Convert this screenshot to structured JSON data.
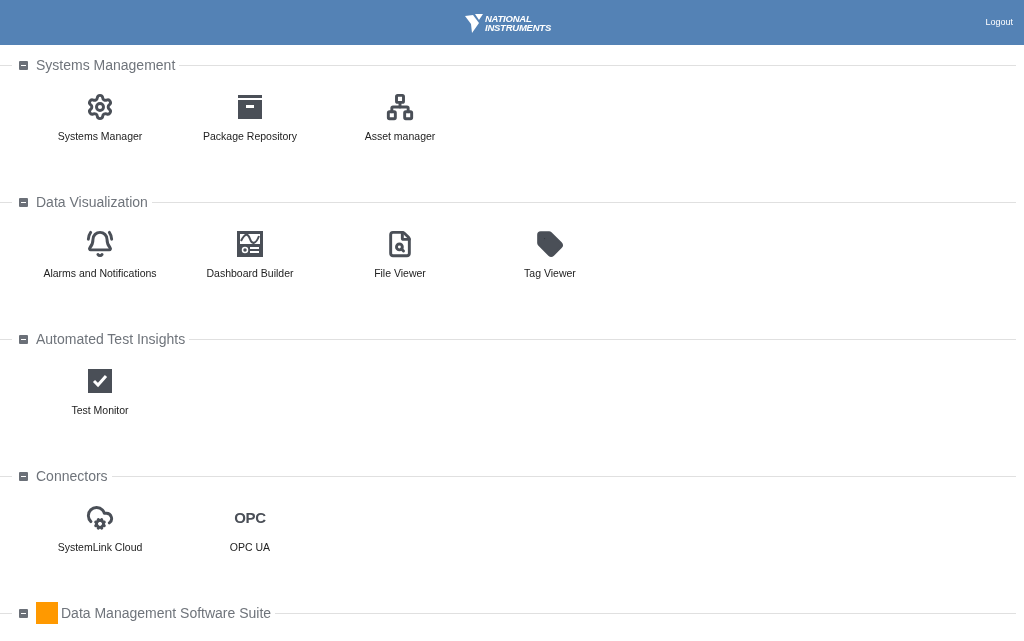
{
  "header": {
    "logo": {
      "line_1": "NATIONAL",
      "line_2": "INSTRUMENTS"
    },
    "logout": "Logout"
  },
  "sections": [
    {
      "title": "Systems Management",
      "expanded": true,
      "badge": false,
      "items": [
        {
          "kind": "gears",
          "label": "Systems Manager"
        },
        {
          "kind": "archive",
          "label": "Package Repository"
        },
        {
          "kind": "hierarchy",
          "label": "Asset manager"
        }
      ]
    },
    {
      "title": "Data Visualization",
      "expanded": true,
      "badge": false,
      "items": [
        {
          "kind": "bell",
          "label": "Alarms and Notifications"
        },
        {
          "kind": "dashboard",
          "label": "Dashboard Builder"
        },
        {
          "kind": "file-search",
          "label": "File Viewer"
        },
        {
          "kind": "tag",
          "label": "Tag Viewer"
        }
      ]
    },
    {
      "title": "Automated Test Insights",
      "expanded": true,
      "badge": false,
      "items": [
        {
          "kind": "check",
          "label": "Test Monitor"
        }
      ]
    },
    {
      "title": "Connectors",
      "expanded": true,
      "badge": false,
      "items": [
        {
          "kind": "cloud",
          "label": "SystemLink Cloud"
        },
        {
          "kind": "text-mark",
          "mark": "OPC",
          "label": "OPC UA"
        }
      ]
    },
    {
      "title": "Data Management Software Suite",
      "expanded": true,
      "badge": true
    }
  ]
}
